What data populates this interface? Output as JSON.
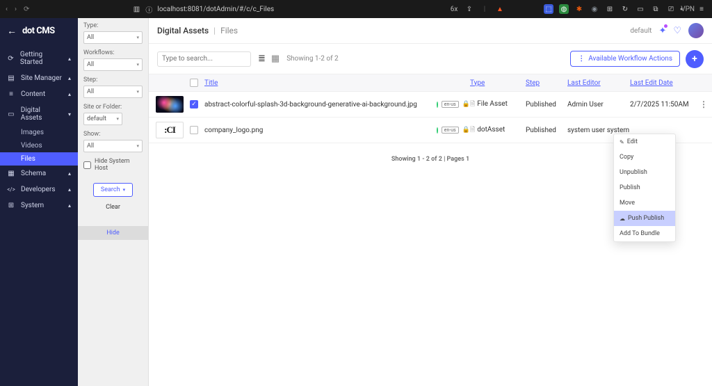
{
  "browser": {
    "url": "localhost:8081/dotAdmin/#/c/c_Files",
    "reader_badge": "6x",
    "vpn_label": "VPN"
  },
  "logo": {
    "prefix": "dot",
    "suffix": "CMS"
  },
  "sidebar": {
    "items": [
      {
        "label": "Getting Started",
        "icon": "⟳"
      },
      {
        "label": "Site Manager",
        "icon": "▤"
      },
      {
        "label": "Content",
        "icon": "≡"
      },
      {
        "label": "Digital Assets",
        "icon": "▭",
        "children": [
          {
            "label": "Images"
          },
          {
            "label": "Videos"
          },
          {
            "label": "Files",
            "active": true
          }
        ]
      },
      {
        "label": "Schema",
        "icon": "▦"
      },
      {
        "label": "Developers",
        "icon": "</>"
      },
      {
        "label": "System",
        "icon": "⊞"
      }
    ]
  },
  "filters": {
    "type": {
      "label": "Type:",
      "value": "All"
    },
    "workflows": {
      "label": "Workflows:",
      "value": "All"
    },
    "step": {
      "label": "Step:",
      "value": "All"
    },
    "site": {
      "label": "Site or Folder:",
      "value": "default"
    },
    "show": {
      "label": "Show:",
      "value": "All"
    },
    "hide_host_label": "Hide System Host",
    "search_btn": "Search",
    "clear": "Clear",
    "hide": "Hide"
  },
  "breadcrumb": {
    "root": "Digital Assets",
    "current": "Files"
  },
  "userbar": {
    "tenant": "default"
  },
  "toolbar": {
    "search_placeholder": "Type to search...",
    "showing": "Showing 1-2 of 2",
    "workflow_btn": "Available Workflow Actions"
  },
  "table": {
    "headers": {
      "title": "Title",
      "type": "Type",
      "step": "Step",
      "editor": "Last Editor",
      "date": "Last Edit Date"
    },
    "rows": [
      {
        "selected": true,
        "thumb_kind": "colorful",
        "title": "abstract-colorful-splash-3d-background-generative-ai-background.jpg",
        "step_tag": "en-us",
        "type": "File Asset",
        "step": "Published",
        "editor": "Admin User",
        "date": "2/7/2025 11:50AM"
      },
      {
        "selected": false,
        "thumb_kind": "logo",
        "thumb_text": ":CI",
        "title": "company_logo.png",
        "step_tag": "en-us",
        "type": "dotAsset",
        "step": "Published",
        "editor": "system user system u",
        "date": ""
      }
    ]
  },
  "pagination": "Showing 1 - 2 of 2 | Pages 1",
  "context_menu": {
    "items": [
      {
        "label": "Edit",
        "icon": "✎"
      },
      {
        "label": "Copy"
      },
      {
        "label": "Unpublish"
      },
      {
        "label": "Publish"
      },
      {
        "label": "Move"
      },
      {
        "label": "Push Publish",
        "icon": "☁",
        "highlighted": true
      },
      {
        "label": "Add To Bundle"
      }
    ]
  }
}
